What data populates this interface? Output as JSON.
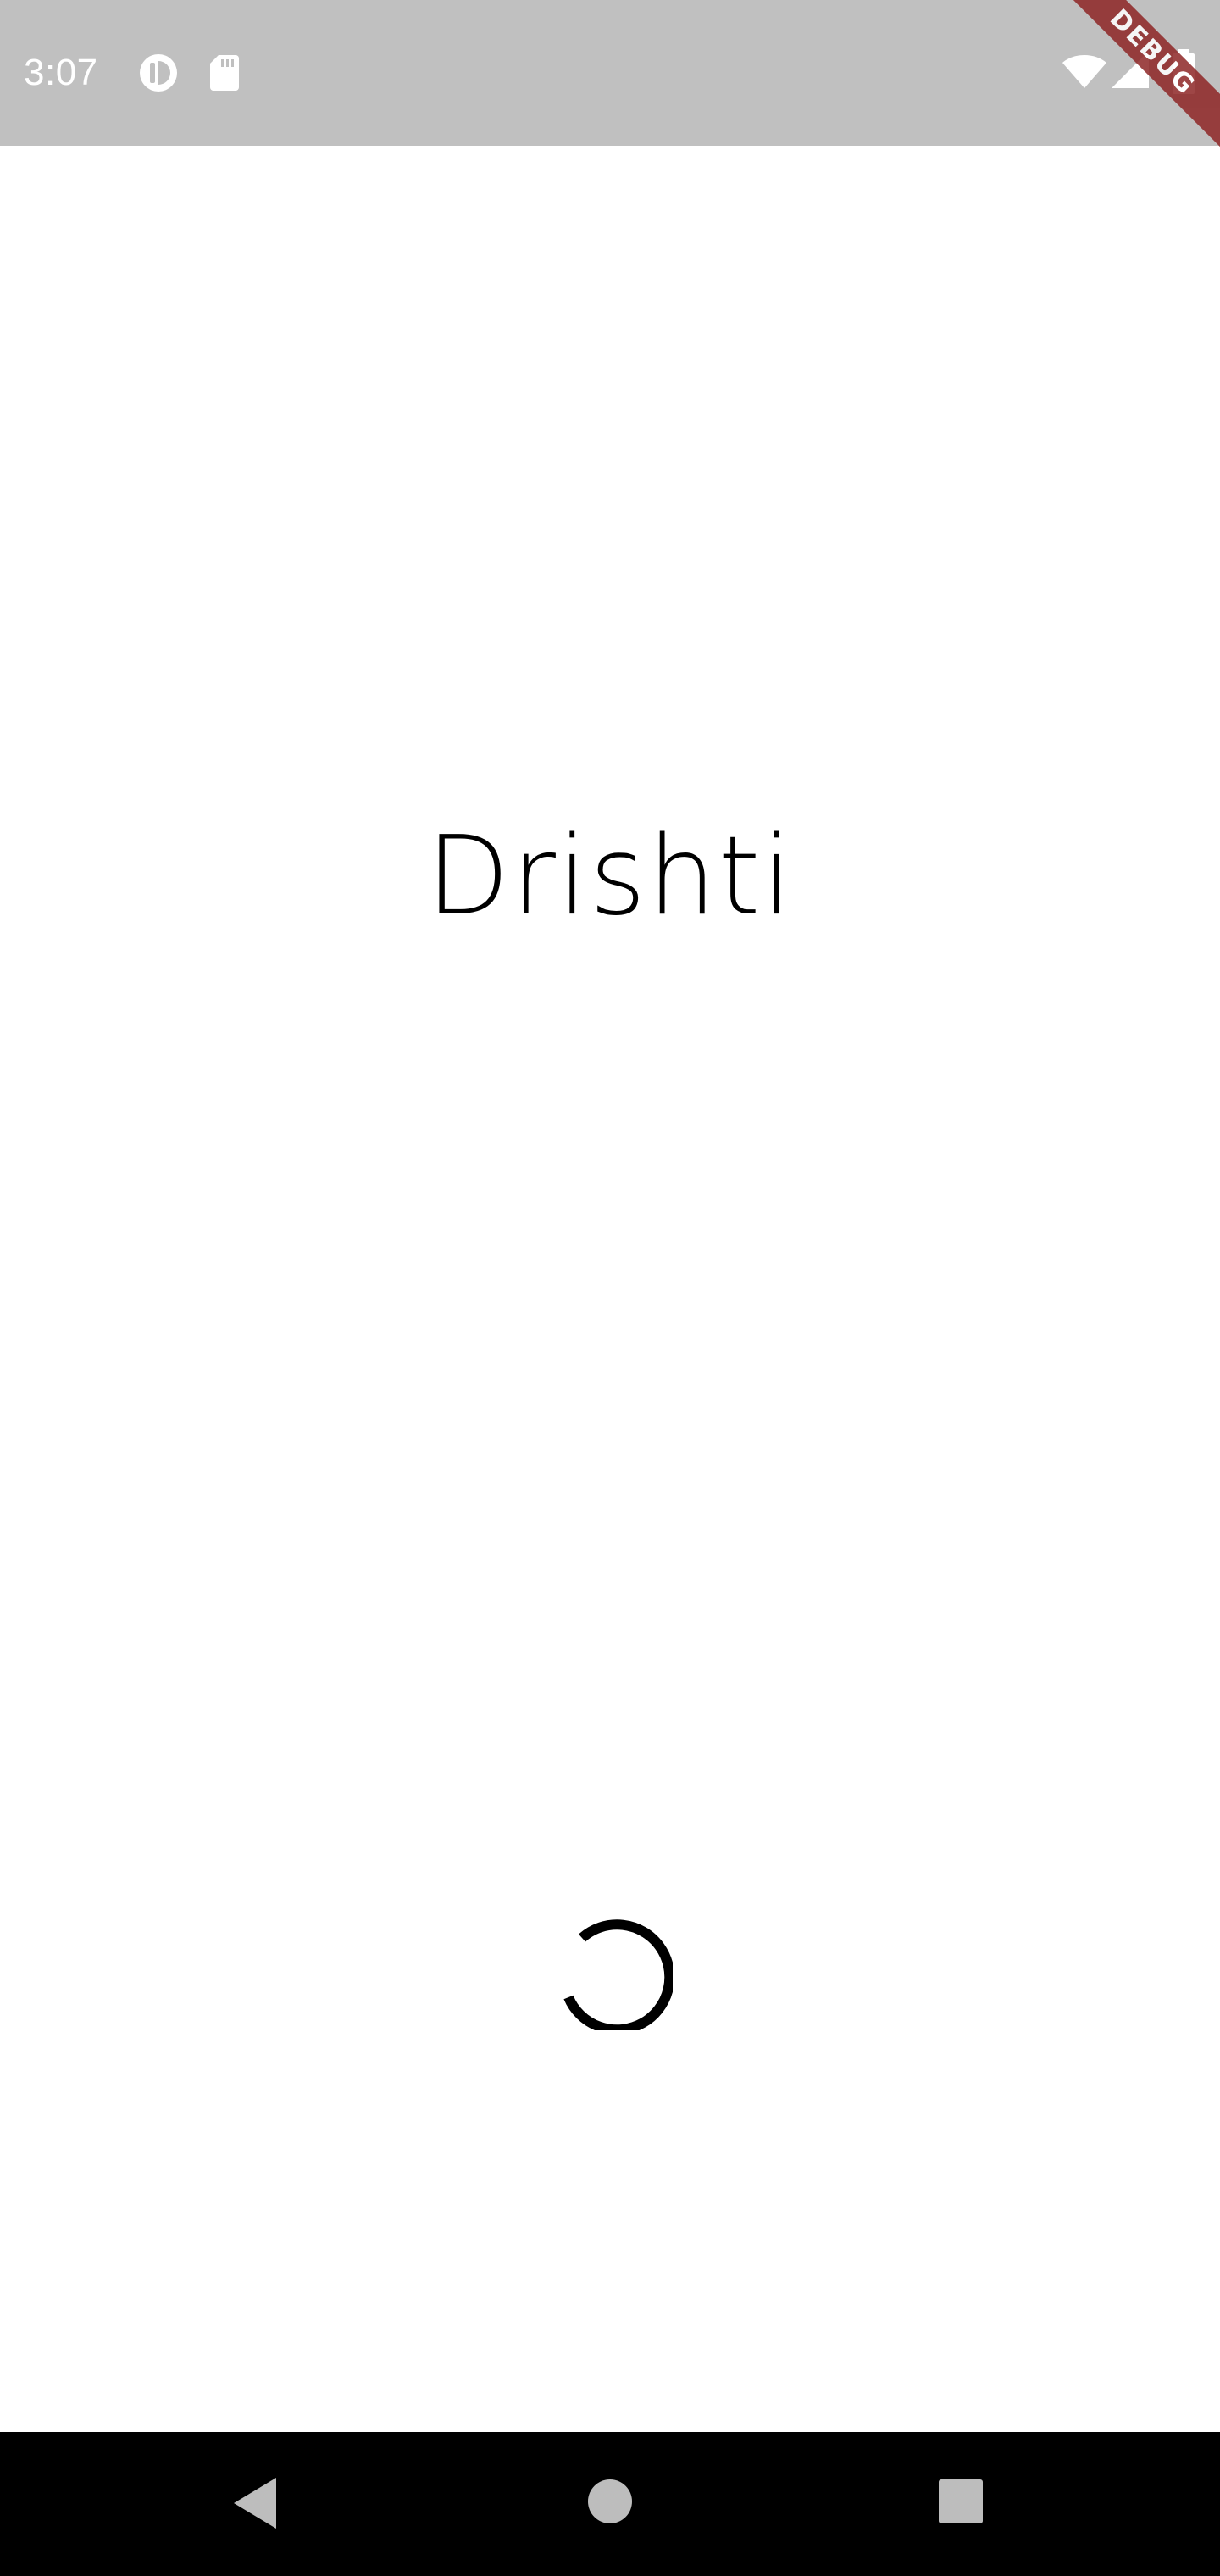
{
  "status_bar": {
    "time": "3:07",
    "icons": [
      "circle-half-icon",
      "sd-card-icon",
      "wifi-icon",
      "cell-signal-icon",
      "battery-icon"
    ],
    "background_color": "#c0c0c0"
  },
  "debug_banner": {
    "label": "DEBUG",
    "color": "#8e2626"
  },
  "app": {
    "title": "Drishti"
  },
  "loading": {
    "icon": "loading-spinner-icon"
  },
  "nav_bar": {
    "buttons": [
      "back-icon",
      "home-icon",
      "recents-icon"
    ],
    "background_color": "#000000"
  }
}
